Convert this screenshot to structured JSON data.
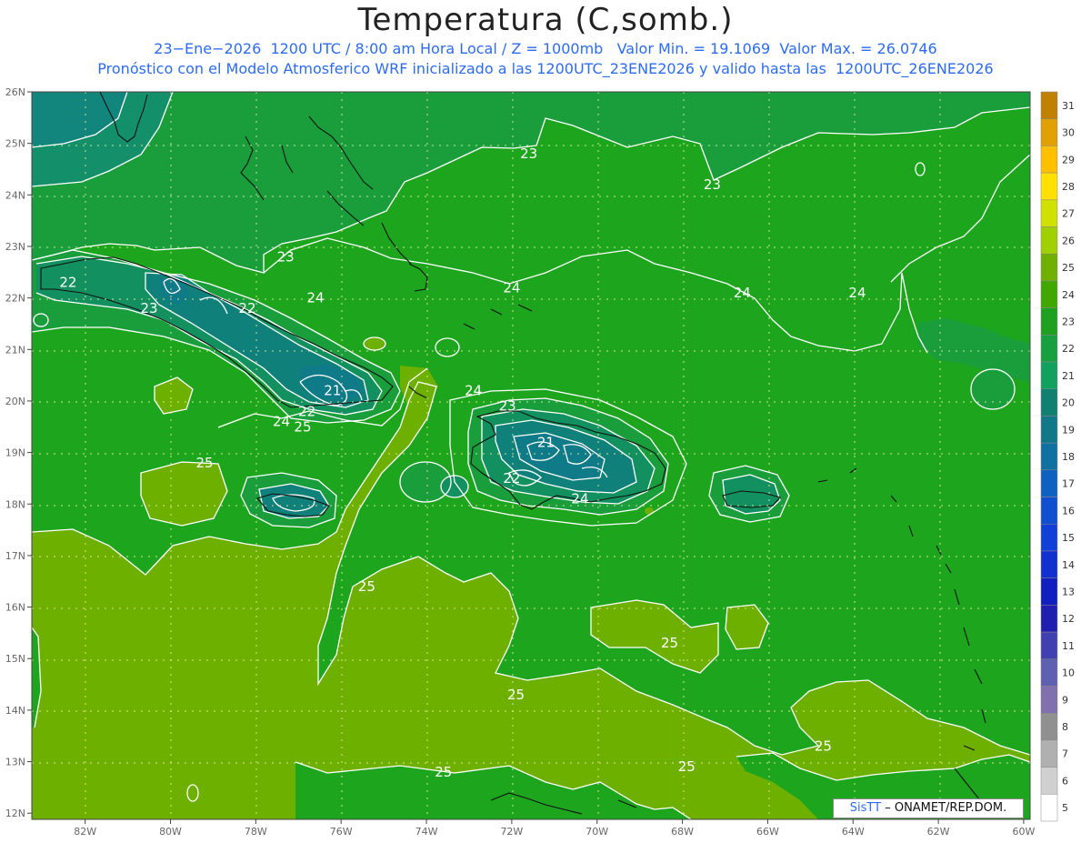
{
  "header": {
    "title": "Temperatura (C,somb.)",
    "line1": "23−Ene−2026  1200 UTC / 8:00 am Hora Local / Z = 1000mb   Valor Min. = 19.1069  Valor Max. = 26.0746",
    "line2": "Pronóstico con el Modelo Atmosferico WRF inicializado a las 1200UTC_23ENE2026 y valido hasta las  1200UTC_26ENE2026"
  },
  "map_axes": {
    "lon_ticks": [
      "82W",
      "80W",
      "78W",
      "76W",
      "74W",
      "72W",
      "70W",
      "68W",
      "66W",
      "64W",
      "62W",
      "60W"
    ],
    "lat_ticks": [
      "26N",
      "25N",
      "24N",
      "23N",
      "22N",
      "21N",
      "20N",
      "19N",
      "18N",
      "17N",
      "16N",
      "15N",
      "14N",
      "13N",
      "12N"
    ]
  },
  "contour_labels": [
    {
      "text": "23",
      "lon": -71.6,
      "lat": 24.8
    },
    {
      "text": "23",
      "lon": -67.3,
      "lat": 24.2
    },
    {
      "text": "23",
      "lon": -77.3,
      "lat": 22.8
    },
    {
      "text": "22",
      "lon": -82.4,
      "lat": 22.3
    },
    {
      "text": "23",
      "lon": -80.5,
      "lat": 21.8
    },
    {
      "text": "22",
      "lon": -78.2,
      "lat": 21.8
    },
    {
      "text": "24",
      "lon": -76.6,
      "lat": 22.0
    },
    {
      "text": "24",
      "lon": -72.0,
      "lat": 22.2
    },
    {
      "text": "24",
      "lon": -66.6,
      "lat": 22.1
    },
    {
      "text": "24",
      "lon": -63.9,
      "lat": 22.1
    },
    {
      "text": "21",
      "lon": -76.2,
      "lat": 20.2
    },
    {
      "text": "22",
      "lon": -76.8,
      "lat": 19.8
    },
    {
      "text": "24",
      "lon": -72.9,
      "lat": 20.2
    },
    {
      "text": "23",
      "lon": -72.1,
      "lat": 19.9
    },
    {
      "text": "24",
      "lon": -77.4,
      "lat": 19.6
    },
    {
      "text": "25",
      "lon": -76.9,
      "lat": 19.5
    },
    {
      "text": "25",
      "lon": -79.2,
      "lat": 18.8
    },
    {
      "text": "21",
      "lon": -71.2,
      "lat": 19.2
    },
    {
      "text": "22",
      "lon": -72.0,
      "lat": 18.5
    },
    {
      "text": "24",
      "lon": -70.4,
      "lat": 18.1
    },
    {
      "text": "25",
      "lon": -75.4,
      "lat": 16.4
    },
    {
      "text": "25",
      "lon": -68.3,
      "lat": 15.3
    },
    {
      "text": "25",
      "lon": -71.9,
      "lat": 14.3
    },
    {
      "text": "25",
      "lon": -64.7,
      "lat": 13.3
    },
    {
      "text": "25",
      "lon": -67.9,
      "lat": 12.9
    },
    {
      "text": "25",
      "lon": -73.6,
      "lat": 12.8
    }
  ],
  "colorbar": {
    "labels": [
      "31",
      "30",
      "29",
      "28",
      "27",
      "26",
      "25",
      "24",
      "23",
      "22",
      "21",
      "20",
      "19",
      "18",
      "17",
      "16",
      "15",
      "14",
      "13",
      "12",
      "11",
      "10",
      "9",
      "8",
      "7",
      "6",
      "5"
    ],
    "colors": [
      "#c08000",
      "#e0a000",
      "#ffc000",
      "#ffe000",
      "#d0e000",
      "#a0d000",
      "#70b000",
      "#40a800",
      "#20a020",
      "#18a040",
      "#10a060",
      "#108070",
      "#107888",
      "#1070a0",
      "#1060c0",
      "#1050d0",
      "#1040d8",
      "#1030d0",
      "#1020c0",
      "#2020b0",
      "#4040b0",
      "#6060b0",
      "#8070b0",
      "#909090",
      "#b0b0b0",
      "#d0d0d0",
      "#ffffff"
    ]
  },
  "credit": {
    "sis": "SisTT",
    "org": "– ONAMET/REP.DOM."
  }
}
